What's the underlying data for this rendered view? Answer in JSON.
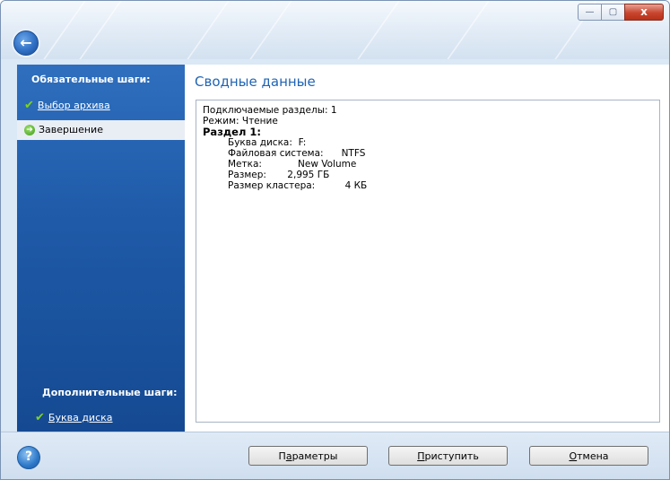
{
  "window": {
    "controls": {
      "minimize": "—",
      "maximize": "▢",
      "close": "x"
    }
  },
  "nav": {
    "back_icon": "←"
  },
  "sidebar": {
    "required_heading": "Обязательные шаги:",
    "required_steps": [
      {
        "label": "Выбор архива",
        "status": "done"
      },
      {
        "label": "Завершение",
        "status": "current"
      }
    ],
    "optional_heading": "Дополнительные шаги:",
    "optional_steps": [
      {
        "label": "Буква диска",
        "status": "done"
      }
    ]
  },
  "main": {
    "title": "Сводные данные",
    "summary": {
      "line1": "Подключаемые разделы: 1",
      "line2": "Режим: Чтение",
      "partition_heading": "Раздел 1:",
      "details": [
        "Буква диска:  F:",
        "Файловая система:      NTFS",
        "Метка:            New Volume",
        "Размер:       2,995 ГБ",
        "Размер кластера:          4 КБ"
      ]
    }
  },
  "footer": {
    "help_icon": "?",
    "params_pre": "П",
    "params_accel": "а",
    "params_post": "раметры",
    "proceed_accel": "П",
    "proceed_post": "риступить",
    "cancel_accel": "О",
    "cancel_post": "тмена"
  },
  "colors": {
    "sidebar": "#1f5ba9",
    "title": "#1f64b5",
    "check": "#7ed321"
  }
}
